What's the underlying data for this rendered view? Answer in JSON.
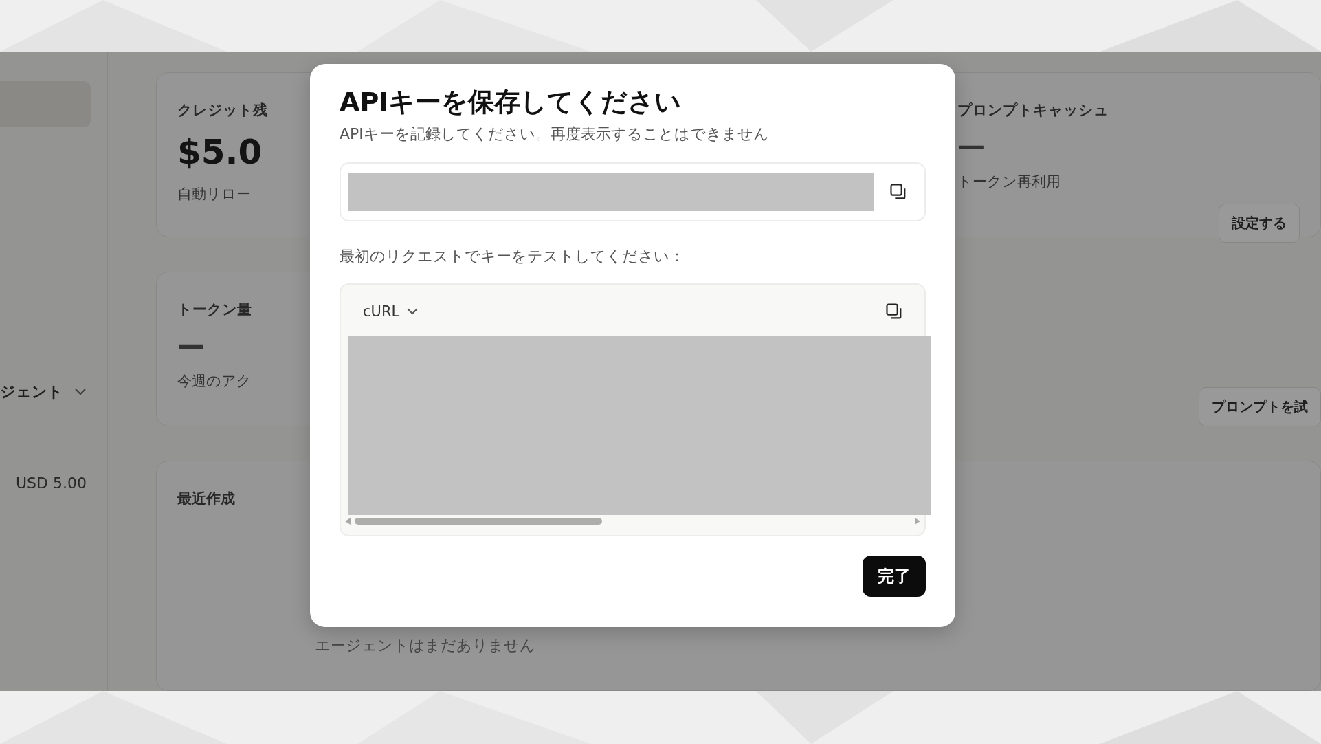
{
  "background": {
    "sidebar": {
      "items": [
        {
          "label": "ジェント"
        }
      ],
      "balance": "USD 5.00"
    },
    "credit_card": {
      "title": "クレジット残",
      "amount": "$5.0",
      "note": "自動リロー"
    },
    "token_card": {
      "title": "トークン量",
      "value": "—",
      "note": "今週のアク"
    },
    "recent_card": {
      "title": "最近作成",
      "empty": "エージェントはまだありません"
    },
    "cache_card": {
      "title": "プロンプトキャッシュ",
      "value": "—",
      "note": "トークン再利用",
      "button": "設定する"
    },
    "try_button": "プロンプトを試"
  },
  "dialog": {
    "title": "APIキーを保存してください",
    "subtitle": "APIキーを記録してください。再度表示することはできません",
    "test_label": "最初のリクエストでキーをテストしてください：",
    "language": "cURL",
    "done": "完了"
  }
}
